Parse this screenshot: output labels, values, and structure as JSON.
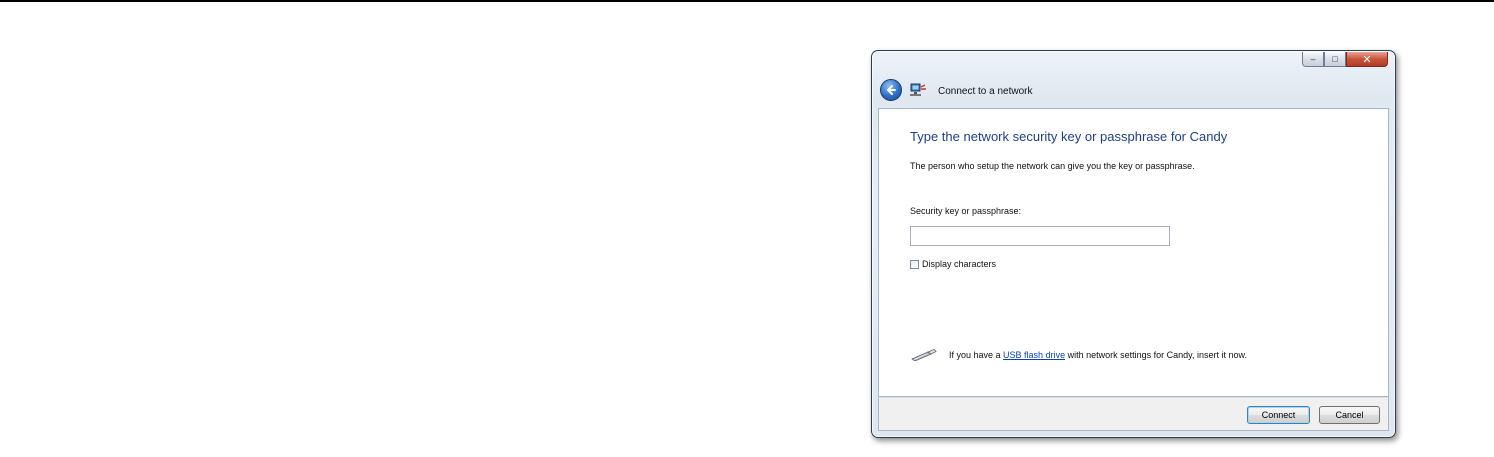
{
  "window": {
    "title": "Connect to a network",
    "controls": {
      "minimize": "–",
      "maximize": "□",
      "close": "✕"
    }
  },
  "content": {
    "headline": "Type the network security key or passphrase for Candy",
    "description": "The person who setup the network can give you the key or passphrase.",
    "key_label": "Security key or passphrase:",
    "key_value": "",
    "display_characters_label": "Display characters",
    "display_characters_checked": false,
    "usb_text_before": "If you have a ",
    "usb_link": "USB flash drive",
    "usb_text_after": " with network settings for Candy, insert it now."
  },
  "footer": {
    "connect_label": "Connect",
    "cancel_label": "Cancel"
  },
  "icons": {
    "back": "back-arrow-icon",
    "network": "network-icon",
    "usb": "usb-drive-icon"
  },
  "colors": {
    "headline": "#1f3f87",
    "link": "#0645ad",
    "close_button": "#c9553d"
  }
}
